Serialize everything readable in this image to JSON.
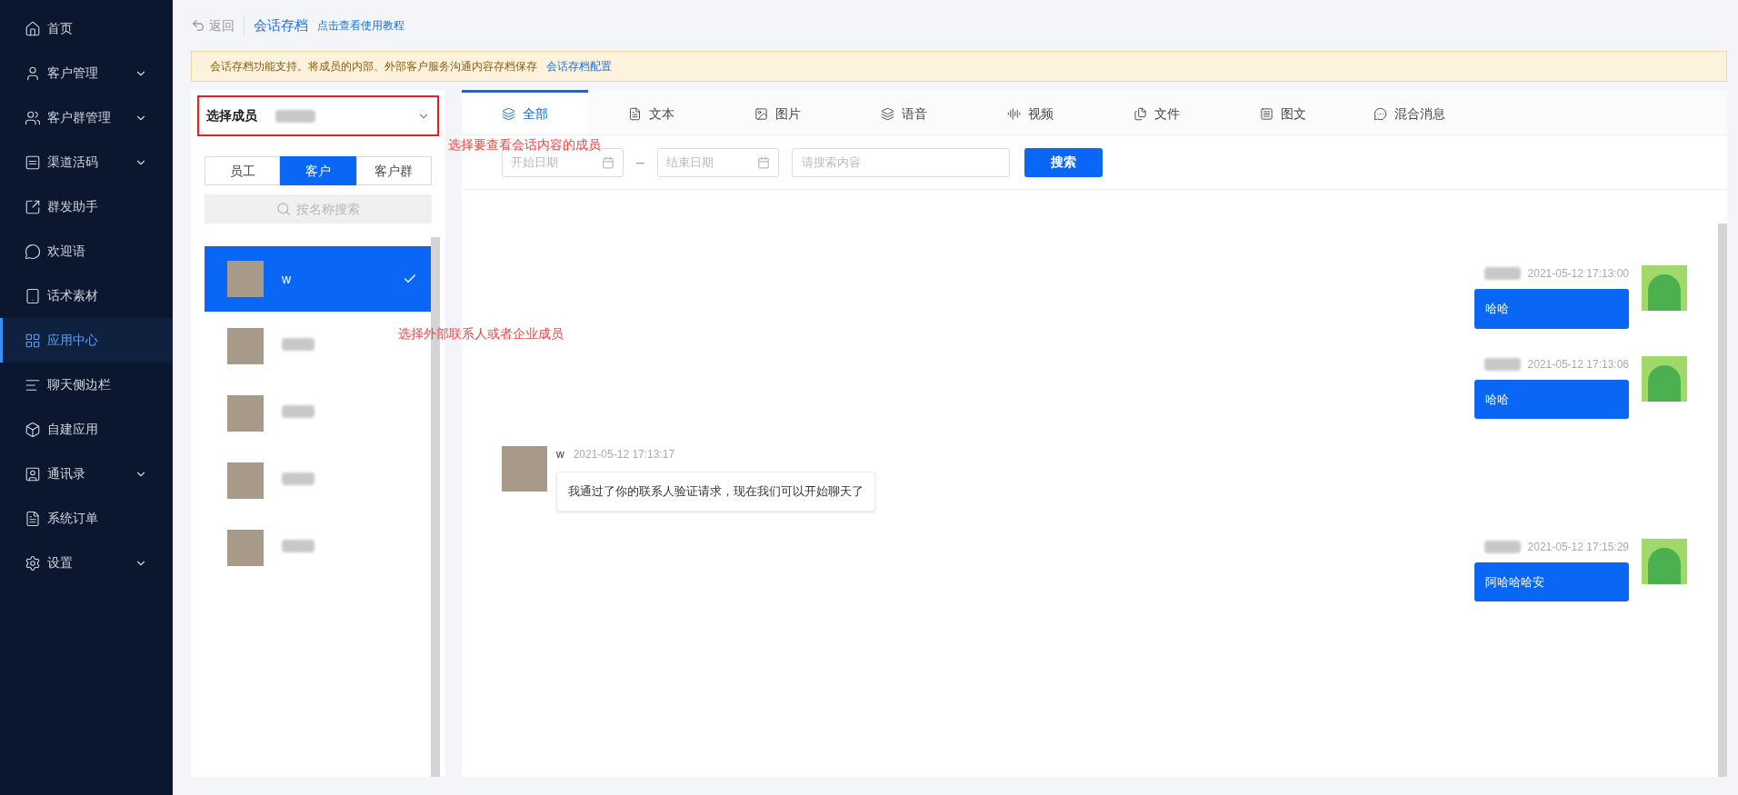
{
  "sidebar": {
    "items": [
      {
        "label": "首页",
        "expandable": false,
        "selected": false
      },
      {
        "label": "客户管理",
        "expandable": true,
        "selected": false
      },
      {
        "label": "客户群管理",
        "expandable": true,
        "selected": false
      },
      {
        "label": "渠道活码",
        "expandable": true,
        "selected": false
      },
      {
        "label": "群发助手",
        "expandable": false,
        "selected": false
      },
      {
        "label": "欢迎语",
        "expandable": false,
        "selected": false
      },
      {
        "label": "话术素材",
        "expandable": false,
        "selected": false
      },
      {
        "label": "应用中心",
        "expandable": false,
        "selected": true
      },
      {
        "label": "聊天侧边栏",
        "expandable": false,
        "selected": false
      },
      {
        "label": "自建应用",
        "expandable": false,
        "selected": false
      },
      {
        "label": "通讯录",
        "expandable": true,
        "selected": false
      },
      {
        "label": "系统订单",
        "expandable": false,
        "selected": false
      },
      {
        "label": "设置",
        "expandable": true,
        "selected": false
      }
    ]
  },
  "header": {
    "back": "返回",
    "title": "会话存档",
    "link": "点击查看使用教程"
  },
  "notice": {
    "text": "会话存档功能支持。将成员的内部、外部客户服务沟通内容存档保存",
    "link": "会话存档配置"
  },
  "member_select": {
    "label": "选择成员"
  },
  "annotations": [
    "选择要查看会话内容的成员",
    "选择外部联系人或者企业成员"
  ],
  "contact_tabs": [
    {
      "label": "员工",
      "selected": false
    },
    {
      "label": "客户",
      "selected": true
    },
    {
      "label": "客户群",
      "selected": false
    }
  ],
  "contact_search": {
    "placeholder": "按名称搜索"
  },
  "contacts": [
    {
      "name": "w",
      "selected": true
    },
    {
      "selected": false
    },
    {
      "selected": false
    },
    {
      "selected": false
    },
    {
      "selected": false
    }
  ],
  "message_tabs": [
    {
      "label": "全部",
      "selected": true
    },
    {
      "label": "文本",
      "selected": false
    },
    {
      "label": "图片",
      "selected": false
    },
    {
      "label": "语音",
      "selected": false
    },
    {
      "label": "视频",
      "selected": false
    },
    {
      "label": "文件",
      "selected": false
    },
    {
      "label": "图文",
      "selected": false
    },
    {
      "label": "混合消息",
      "selected": false
    }
  ],
  "filters": {
    "start_placeholder": "开始日期",
    "separator": "–",
    "end_placeholder": "结束日期",
    "search_placeholder": "请搜索内容",
    "button": "搜索"
  },
  "messages": [
    {
      "kind": "sent",
      "time": "2021-05-12 17:13:00",
      "text": "哈哈"
    },
    {
      "kind": "sent",
      "time": "2021-05-12 17:13:06",
      "text": "哈哈"
    },
    {
      "kind": "received",
      "sender": "w",
      "time": "2021-05-12 17:13:17",
      "text": "我通过了你的联系人验证请求，现在我们可以开始聊天了"
    },
    {
      "kind": "sent",
      "time": "2021-05-12 17:15:29",
      "text": "阿哈哈哈安"
    }
  ]
}
